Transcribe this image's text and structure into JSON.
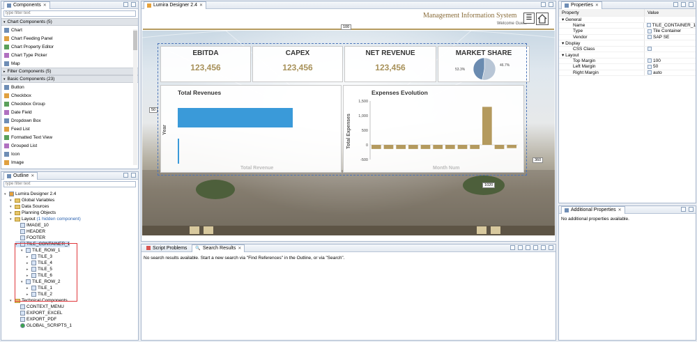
{
  "components": {
    "title": "Components",
    "filter_placeholder": "type filter text",
    "chart_group": "Chart Components (5)",
    "chart_items": [
      "Chart",
      "Chart Feeding Panel",
      "Chart Property Editor",
      "Chart Type Picker",
      "Map"
    ],
    "filter_group": "Filter Components (5)",
    "basic_group": "Basic Components (23)",
    "basic_items": [
      "Button",
      "Checkbox",
      "Checkbox Group",
      "Date Field",
      "Dropdown Box",
      "Feed List",
      "Formatted Text View",
      "Grouped List",
      "Icon",
      "Image"
    ]
  },
  "outline": {
    "title": "Outline",
    "filter_placeholder": "type filter text",
    "items": [
      {
        "label": "Lumira Designer 2.4",
        "indent": 0,
        "kind": "app"
      },
      {
        "label": "Global Variables",
        "indent": 1,
        "kind": "folder"
      },
      {
        "label": "Data Sources",
        "indent": 1,
        "kind": "folder"
      },
      {
        "label": "Planning Objects",
        "indent": 1,
        "kind": "folder"
      },
      {
        "label": "Layout",
        "note": "(1 hidden component)",
        "indent": 1,
        "kind": "folder"
      },
      {
        "label": "IMAGE_10",
        "indent": 2,
        "kind": "comp"
      },
      {
        "label": "HEADER",
        "indent": 2,
        "kind": "comp"
      },
      {
        "label": "FOOTER",
        "indent": 2,
        "kind": "comp"
      },
      {
        "label": "TILE_CONTAINER_1",
        "indent": 2,
        "kind": "comp",
        "selected": true
      },
      {
        "label": "TILE_ROW_1",
        "indent": 3,
        "kind": "comp"
      },
      {
        "label": "TILE_3",
        "indent": 4,
        "kind": "comp"
      },
      {
        "label": "TILE_4",
        "indent": 4,
        "kind": "comp"
      },
      {
        "label": "TILE_5",
        "indent": 4,
        "kind": "comp"
      },
      {
        "label": "TILE_6",
        "indent": 4,
        "kind": "comp"
      },
      {
        "label": "TILE_ROW_2",
        "indent": 3,
        "kind": "comp"
      },
      {
        "label": "TILE_1",
        "indent": 4,
        "kind": "comp"
      },
      {
        "label": "TILE_2",
        "indent": 4,
        "kind": "comp"
      },
      {
        "label": "Technical Components",
        "indent": 1,
        "kind": "folder"
      },
      {
        "label": "CONTEXT_MENU",
        "indent": 2,
        "kind": "comp"
      },
      {
        "label": "EXPORT_EXCEL",
        "indent": 2,
        "kind": "comp"
      },
      {
        "label": "EXPORT_PDF",
        "indent": 2,
        "kind": "comp"
      },
      {
        "label": "GLOBAL_SCRIPTS_1",
        "indent": 2,
        "kind": "script"
      }
    ]
  },
  "editor": {
    "tab": "Lumira Designer 2.4",
    "header_title": "Management Information System",
    "welcome": "Welcome Guest",
    "guides": {
      "top": "100",
      "left": "50",
      "right": "360",
      "bottom": "1020"
    }
  },
  "tiles": [
    {
      "title": "EBITDA",
      "value": "123,456"
    },
    {
      "title": "CAPEX",
      "value": "123,456"
    },
    {
      "title": "NET REVENUE",
      "value": "123,456"
    },
    {
      "title": "MARKET SHARE"
    }
  ],
  "pie": {
    "labels": [
      "53.3%",
      "46.7%"
    ],
    "values": [
      53.3,
      46.7
    ],
    "colors": [
      "#b8c6d6",
      "#6a8bb0"
    ]
  },
  "chart_data": [
    {
      "type": "bar",
      "title": "Total Revenues",
      "xlabel": "Total Revenue",
      "ylabel": "Year",
      "orientation": "horizontal",
      "color": "#3a9ad9"
    },
    {
      "type": "bar",
      "title": "Expenses Evolution",
      "xlabel": "Month Num",
      "ylabel": "Total Expenses",
      "y_ticks": [
        "1,500",
        "1,000",
        "500",
        "0",
        "-500"
      ],
      "ylim": [
        -500,
        1500
      ],
      "values": [
        -140,
        -140,
        -140,
        -140,
        -140,
        -140,
        -140,
        -140,
        -140,
        1300,
        -140,
        -110
      ],
      "color": "#b49a5e"
    }
  ],
  "bottom": {
    "tabs": [
      "Script Problems",
      "Search Results"
    ],
    "message": "No search results available. Start a new search via \"Find References\" in the Outline, or via \"Search\"."
  },
  "properties": {
    "title": "Properties",
    "col_property": "Property",
    "col_value": "Value",
    "rows": [
      {
        "label": "General",
        "group": true
      },
      {
        "label": "Name",
        "value": "TILE_CONTAINER_1"
      },
      {
        "label": "Type",
        "value": "Tile Container"
      },
      {
        "label": "Vendor",
        "value": "SAP SE"
      },
      {
        "label": "Display",
        "group": true
      },
      {
        "label": "CSS Class",
        "value": ""
      },
      {
        "label": "Layout",
        "group": true
      },
      {
        "label": "Top Margin",
        "value": "100"
      },
      {
        "label": "Left Margin",
        "value": "50"
      },
      {
        "label": "Right Margin",
        "value": "auto"
      }
    ]
  },
  "additional": {
    "title": "Additional Properties",
    "message": "No additional properties available."
  }
}
